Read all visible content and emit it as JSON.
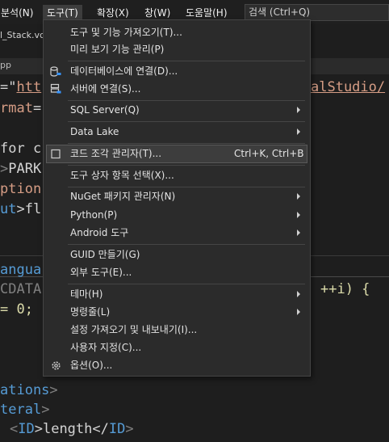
{
  "menubar": {
    "items": [
      "분석(N)",
      "도구(T)",
      "확장(X)",
      "창(W)",
      "도움말(H)"
    ],
    "search": "검색 (Ctrl+Q)"
  },
  "background": {
    "tab_title": "l_Stack.vcx",
    "sub_title": "pp",
    "code": {
      "l1a": "=\"",
      "l1b": "htt",
      "l1c": "alStudio/",
      "l2a": "rmat",
      "l2b": "=",
      "l3": "for c",
      "l4a": ">",
      "l4b": "PARK",
      "l5": "ption",
      "l6a": "ut",
      "l6b": ">fl",
      "l7": "angua",
      "l8": "CDATA",
      "l8b": "++i) {",
      "l9": "= 0;",
      "l10a": "ations",
      "l10b": ">",
      "l11a": "teral",
      "l11b": ">",
      "l12a": "<",
      "l12b": "ID",
      "l12c": ">length</",
      "l12d": "ID",
      "l12e": ">"
    }
  },
  "menu": {
    "items": [
      {
        "label": "도구 및 기능 가져오기(T)..."
      },
      {
        "label": "미리 보기 기능 관리(P)"
      },
      {
        "label": "데이터베이스에 연결(D)..."
      },
      {
        "label": "서버에 연결(S)..."
      },
      {
        "label": "SQL Server(Q)"
      },
      {
        "label": "Data Lake"
      },
      {
        "label": "코드 조각 관리자(T)...",
        "shortcut": "Ctrl+K, Ctrl+B"
      },
      {
        "label": "도구 상자 항목 선택(X)..."
      },
      {
        "label": "NuGet 패키지 관리자(N)"
      },
      {
        "label": "Python(P)"
      },
      {
        "label": "Android 도구"
      },
      {
        "label": "GUID 만들기(G)"
      },
      {
        "label": "외부 도구(E)..."
      },
      {
        "label": "테마(H)"
      },
      {
        "label": "명령줄(L)"
      },
      {
        "label": "설정 가져오기 및 내보내기(I)..."
      },
      {
        "label": "사용자 지정(C)..."
      },
      {
        "label": "옵션(O)..."
      }
    ]
  }
}
